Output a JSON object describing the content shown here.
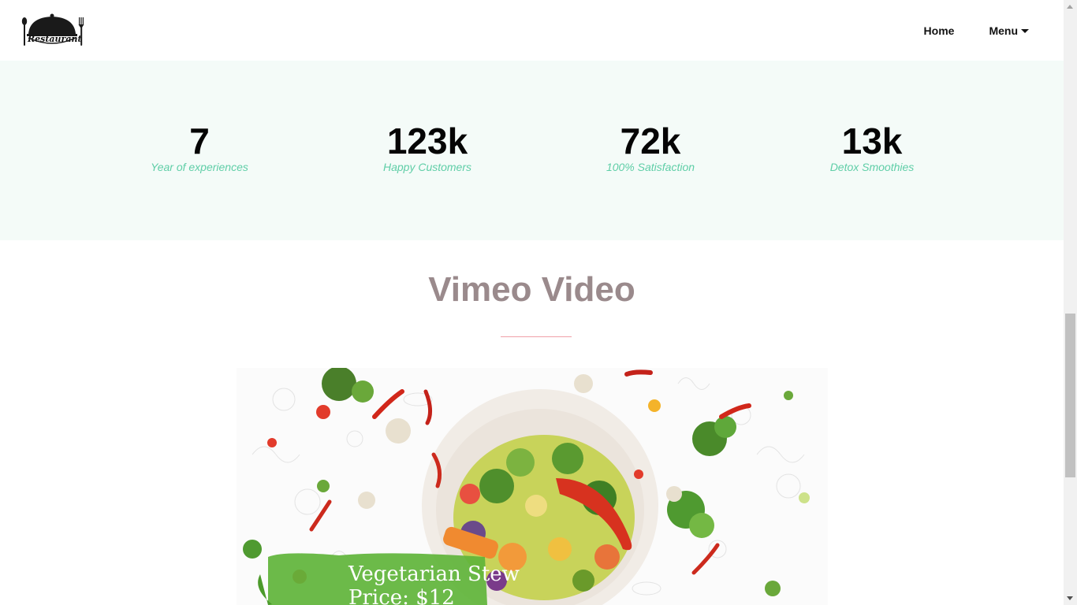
{
  "header": {
    "logo_text": "Restaurant",
    "nav": {
      "home_label": "Home",
      "menu_label": "Menu"
    }
  },
  "stats": [
    {
      "value": "7",
      "label": "Year of experiences"
    },
    {
      "value": "123k",
      "label": "Happy Customers"
    },
    {
      "value": "72k",
      "label": "100% Satisfaction"
    },
    {
      "value": "13k",
      "label": "Detox Smoothies"
    }
  ],
  "video_section": {
    "title": "Vimeo Video",
    "video_caption_line1": "Vegetarian Stew",
    "video_caption_line2": "Price: $12"
  },
  "colors": {
    "accent_green": "#5fcea7",
    "stats_background": "#f4fbf8",
    "title_color": "#9a8a8c",
    "divider_pink": "#f0a0a8",
    "caption_green": "#5fb43a"
  }
}
